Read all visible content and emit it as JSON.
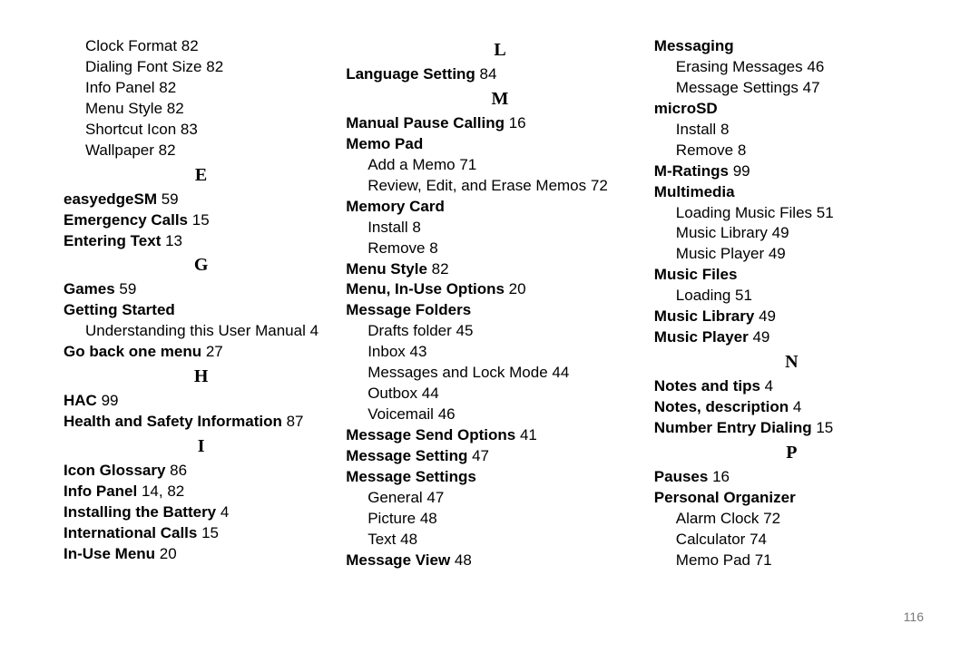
{
  "page_number": "116",
  "columns": [
    {
      "items": [
        {
          "type": "sub",
          "text": "Clock Format",
          "page": "82"
        },
        {
          "type": "sub",
          "text": "Dialing Font Size",
          "page": "82"
        },
        {
          "type": "sub",
          "text": "Info Panel",
          "page": "82"
        },
        {
          "type": "sub",
          "text": "Menu Style",
          "page": "82"
        },
        {
          "type": "sub",
          "text": "Shortcut Icon",
          "page": "83"
        },
        {
          "type": "sub",
          "text": "Wallpaper",
          "page": "82"
        },
        {
          "type": "letter",
          "text": "E"
        },
        {
          "type": "term",
          "text": "easyedgeSM",
          "page": "59"
        },
        {
          "type": "term",
          "text": "Emergency Calls",
          "page": "15"
        },
        {
          "type": "term",
          "text": "Entering Text",
          "page": "13"
        },
        {
          "type": "letter",
          "text": "G"
        },
        {
          "type": "term",
          "text": "Games",
          "page": "59"
        },
        {
          "type": "term",
          "text": "Getting Started"
        },
        {
          "type": "sub",
          "text": "Understanding this User Manual",
          "page": "4"
        },
        {
          "type": "term",
          "text": "Go back one menu",
          "page": "27"
        },
        {
          "type": "letter",
          "text": "H"
        },
        {
          "type": "term",
          "text": "HAC",
          "page": "99"
        },
        {
          "type": "term",
          "text": "Health and Safety Information",
          "page": "87"
        },
        {
          "type": "letter",
          "text": "I"
        },
        {
          "type": "term",
          "text": "Icon Glossary",
          "page": "86"
        },
        {
          "type": "term",
          "text": "Info Panel",
          "page": "14, 82"
        },
        {
          "type": "term",
          "text": "Installing the Battery",
          "page": "4"
        },
        {
          "type": "term",
          "text": "International Calls",
          "page": "15"
        },
        {
          "type": "term",
          "text": "In-Use Menu",
          "page": "20"
        }
      ]
    },
    {
      "items": [
        {
          "type": "letter",
          "text": "L"
        },
        {
          "type": "term",
          "text": "Language Setting",
          "page": "84"
        },
        {
          "type": "letter",
          "text": "M"
        },
        {
          "type": "term",
          "text": "Manual Pause Calling",
          "page": "16"
        },
        {
          "type": "term",
          "text": "Memo Pad"
        },
        {
          "type": "sub",
          "text": "Add a Memo",
          "page": "71"
        },
        {
          "type": "sub",
          "text": "Review, Edit, and Erase Memos",
          "page": "72"
        },
        {
          "type": "term",
          "text": "Memory Card"
        },
        {
          "type": "sub",
          "text": "Install",
          "page": "8"
        },
        {
          "type": "sub",
          "text": "Remove",
          "page": "8"
        },
        {
          "type": "term",
          "text": "Menu Style",
          "page": "82"
        },
        {
          "type": "term",
          "text": "Menu, In-Use Options",
          "page": "20"
        },
        {
          "type": "term",
          "text": "Message Folders"
        },
        {
          "type": "sub",
          "text": "Drafts folder",
          "page": "45"
        },
        {
          "type": "sub",
          "text": "Inbox",
          "page": "43"
        },
        {
          "type": "sub",
          "text": "Messages and Lock Mode",
          "page": "44"
        },
        {
          "type": "sub",
          "text": "Outbox",
          "page": "44"
        },
        {
          "type": "sub",
          "text": "Voicemail",
          "page": "46"
        },
        {
          "type": "term",
          "text": "Message Send Options",
          "page": "41"
        },
        {
          "type": "term",
          "text": "Message Setting",
          "page": "47"
        },
        {
          "type": "term",
          "text": "Message Settings"
        },
        {
          "type": "sub",
          "text": "General",
          "page": "47"
        },
        {
          "type": "sub",
          "text": "Picture",
          "page": "48"
        },
        {
          "type": "sub",
          "text": "Text",
          "page": "48"
        },
        {
          "type": "term",
          "text": "Message View",
          "page": "48"
        }
      ]
    },
    {
      "items": [
        {
          "type": "term",
          "text": "Messaging"
        },
        {
          "type": "sub",
          "text": "Erasing Messages",
          "page": "46"
        },
        {
          "type": "sub",
          "text": "Message Settings",
          "page": "47"
        },
        {
          "type": "term",
          "text": "microSD"
        },
        {
          "type": "sub",
          "text": "Install",
          "page": "8"
        },
        {
          "type": "sub",
          "text": "Remove",
          "page": "8"
        },
        {
          "type": "term",
          "text": "M-Ratings",
          "page": "99"
        },
        {
          "type": "term",
          "text": "Multimedia"
        },
        {
          "type": "sub",
          "text": "Loading Music Files",
          "page": "51"
        },
        {
          "type": "sub",
          "text": "Music Library",
          "page": "49"
        },
        {
          "type": "sub",
          "text": "Music Player",
          "page": "49"
        },
        {
          "type": "term",
          "text": "Music Files"
        },
        {
          "type": "sub",
          "text": "Loading",
          "page": "51"
        },
        {
          "type": "term",
          "text": "Music Library",
          "page": "49"
        },
        {
          "type": "term",
          "text": "Music Player",
          "page": "49"
        },
        {
          "type": "letter",
          "text": "N"
        },
        {
          "type": "term",
          "text": "Notes and tips",
          "page": "4"
        },
        {
          "type": "term",
          "text": "Notes, description",
          "page": "4"
        },
        {
          "type": "term",
          "text": "Number Entry Dialing",
          "page": "15"
        },
        {
          "type": "letter",
          "text": "P"
        },
        {
          "type": "term",
          "text": "Pauses",
          "page": "16"
        },
        {
          "type": "term",
          "text": "Personal Organizer"
        },
        {
          "type": "sub",
          "text": "Alarm Clock",
          "page": "72"
        },
        {
          "type": "sub",
          "text": "Calculator",
          "page": "74"
        },
        {
          "type": "sub",
          "text": "Memo Pad",
          "page": "71"
        }
      ]
    }
  ]
}
